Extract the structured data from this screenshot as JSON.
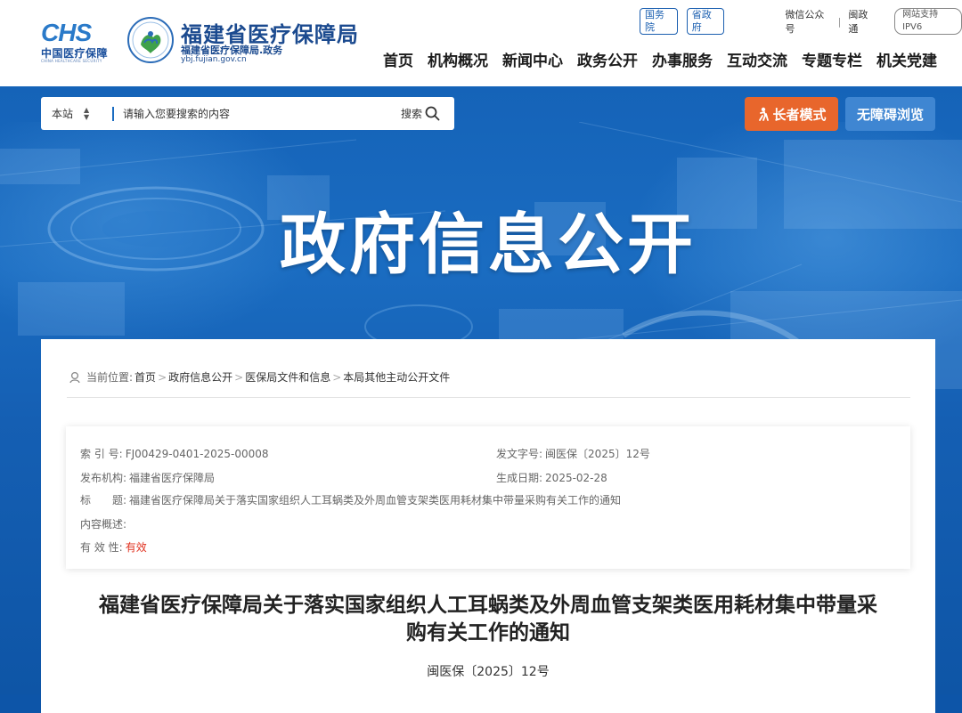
{
  "header": {
    "chs_mark": "CHS",
    "chs_cn": "中国医疗保障",
    "chs_en": "CHINA HEALTHCARE SECURITY",
    "bureau_name": "福建省医疗保障局",
    "bureau_domain_cn": "福建省医疗保障局.政务",
    "bureau_domain_url": "ybj.fujian.gov.cn",
    "top_links": {
      "state_council": "国务院",
      "provincial_gov": "省政府",
      "wechat": "微信公众号",
      "separator": "|",
      "min_zheng_tong": "闽政通",
      "ipv6": "网站支持IPV6"
    },
    "nav": [
      "首页",
      "机构概况",
      "新闻中心",
      "政务公开",
      "办事服务",
      "互动交流",
      "专题专栏",
      "机关党建"
    ]
  },
  "banner": {
    "search": {
      "scope": "本站",
      "placeholder": "请输入您要搜索的内容",
      "button_label": "搜索"
    },
    "elder_mode": "长者模式",
    "accessible_browse": "无障碍浏览",
    "title": "政府信息公开"
  },
  "content": {
    "breadcrumb": {
      "label": "当前位置:",
      "items": [
        "首页",
        "政府信息公开",
        "医保局文件和信息",
        "本局其他主动公开文件"
      ],
      "separator": ">"
    },
    "meta": {
      "index_no": {
        "key": "索 引 号:",
        "value": "FJ00429-0401-2025-00008"
      },
      "doc_no": {
        "key": "发文字号:",
        "value": "闽医保〔2025〕12号"
      },
      "issuer": {
        "key": "发布机构:",
        "value": "福建省医疗保障局"
      },
      "date": {
        "key": "生成日期:",
        "value": "2025-02-28"
      },
      "title": {
        "key": "标　　题:",
        "value": "福建省医疗保障局关于落实国家组织人工耳蜗类及外周血管支架类医用耗材集中带量采购有关工作的通知"
      },
      "summary": {
        "key": "内容概述:",
        "value": ""
      },
      "validity": {
        "key": "有 效 性:",
        "value": "有效"
      }
    },
    "doc_title_line1": "福建省医疗保障局关于落实国家组织人工耳蜗类及外周血管支架类医用耗材集中带量采",
    "doc_title_line2": "购有关工作的通知",
    "doc_number": "闽医保〔2025〕12号"
  },
  "colors": {
    "brand_blue": "#1b4a8f",
    "banner_blue": "#1563b8",
    "elder_orange": "#e8662c",
    "access_blue": "#3f86d2",
    "valid_red": "#e0301e"
  }
}
